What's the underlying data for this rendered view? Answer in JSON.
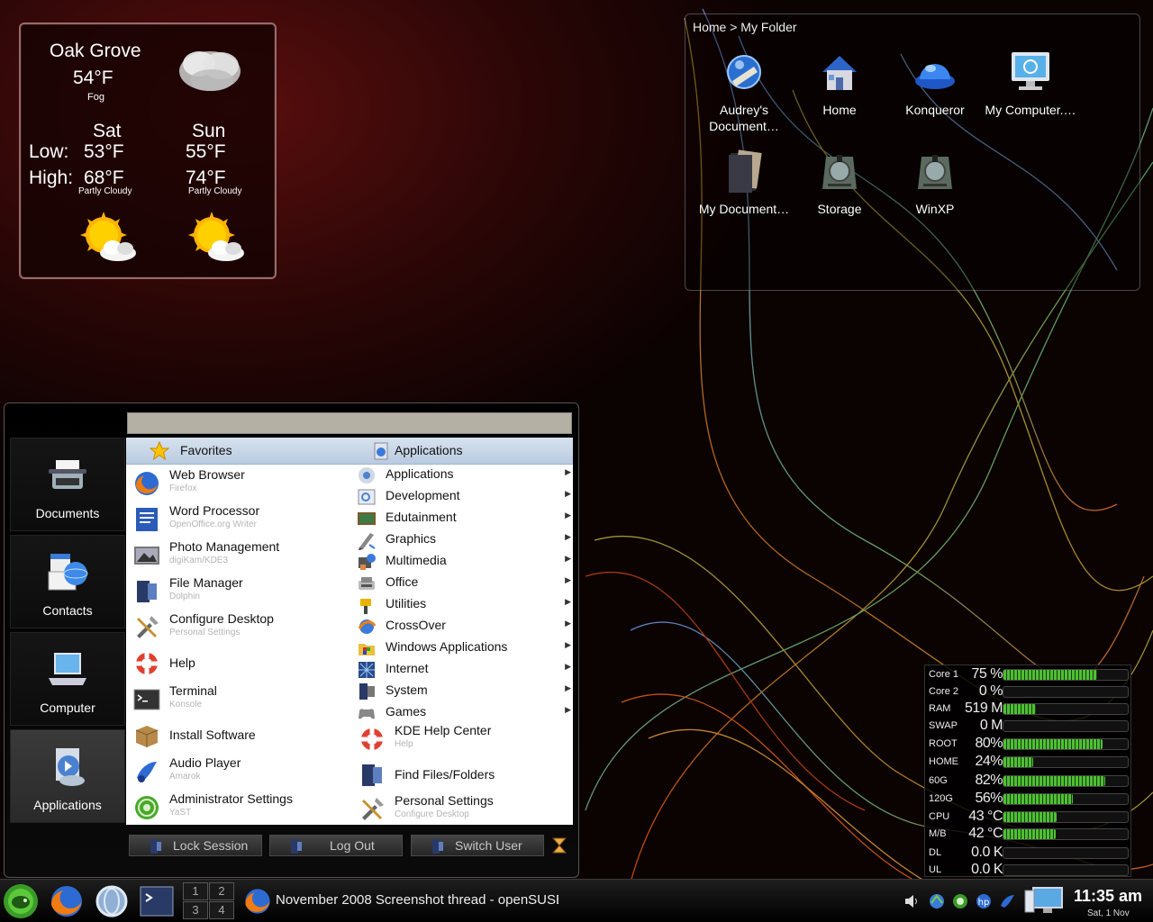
{
  "weather": {
    "city": "Oak Grove",
    "temp_now": "54°F",
    "condition_now": "Fog",
    "days": [
      {
        "day": "Sat",
        "low": "53°F",
        "high": "68°F",
        "condition": "Partly Cloudy"
      },
      {
        "day": "Sun",
        "low": "55°F",
        "high": "74°F",
        "condition": "Partly Cloudy"
      }
    ],
    "low_label": "Low:",
    "high_label": "High:"
  },
  "folder_view": {
    "breadcrumb": "Home > My Folder",
    "items": [
      {
        "label": "Audrey's Document…",
        "icon": "folder-documents-icon"
      },
      {
        "label": "Home",
        "icon": "home-icon"
      },
      {
        "label": "Konqueror",
        "icon": "konqueror-icon"
      },
      {
        "label": "My Computer.…",
        "icon": "computer-icon"
      },
      {
        "label": "My Document…",
        "icon": "documents-icon"
      },
      {
        "label": "Storage",
        "icon": "drive-icon"
      },
      {
        "label": "WinXP",
        "icon": "drive-icon"
      }
    ]
  },
  "menu": {
    "left_categories": [
      {
        "label": "Documents",
        "icon": "typewriter-icon"
      },
      {
        "label": "Contacts",
        "icon": "contacts-icon"
      },
      {
        "label": "Computer",
        "icon": "laptop-icon"
      },
      {
        "label": "Applications",
        "icon": "applications-icon"
      }
    ],
    "favorites_header": "Favorites",
    "applications_header": "Applications",
    "favorites": [
      {
        "name": "Web Browser",
        "desc": "Firefox",
        "icon": "firefox-icon"
      },
      {
        "name": "Word Processor",
        "desc": "OpenOffice.org Writer",
        "icon": "writer-icon"
      },
      {
        "name": "Photo Management",
        "desc": "digiKam/KDE3",
        "icon": "photo-icon"
      },
      {
        "name": "File Manager",
        "desc": "Dolphin",
        "icon": "file-manager-icon"
      },
      {
        "name": "Configure Desktop",
        "desc": "Personal Settings",
        "icon": "tools-icon"
      },
      {
        "name": "Help",
        "desc": "",
        "icon": "help-icon"
      },
      {
        "name": "Terminal",
        "desc": "Konsole",
        "icon": "terminal-icon"
      },
      {
        "name": "Install Software",
        "desc": "",
        "icon": "package-icon"
      },
      {
        "name": "Audio Player",
        "desc": "Amarok",
        "icon": "amarok-icon"
      },
      {
        "name": "Administrator Settings",
        "desc": "YaST",
        "icon": "yast-icon"
      }
    ],
    "applications": [
      {
        "name": "Applications",
        "icon": "applications-icon"
      },
      {
        "name": "Development",
        "icon": "development-icon"
      },
      {
        "name": "Edutainment",
        "icon": "edutainment-icon"
      },
      {
        "name": "Graphics",
        "icon": "graphics-icon"
      },
      {
        "name": "Multimedia",
        "icon": "multimedia-icon"
      },
      {
        "name": "Office",
        "icon": "office-icon"
      },
      {
        "name": "Utilities",
        "icon": "utilities-icon"
      },
      {
        "name": "CrossOver",
        "icon": "crossover-icon"
      },
      {
        "name": "Windows Applications",
        "icon": "windows-apps-icon"
      },
      {
        "name": "Internet",
        "icon": "internet-icon"
      },
      {
        "name": "System",
        "icon": "system-icon"
      },
      {
        "name": "Games",
        "icon": "games-icon"
      }
    ],
    "extra_items": [
      {
        "name": "KDE Help Center",
        "desc": "Help",
        "icon": "help-icon"
      },
      {
        "name": "Find Files/Folders",
        "desc": "",
        "icon": "find-icon"
      },
      {
        "name": "Personal Settings",
        "desc": "Configure Desktop",
        "icon": "tools-icon"
      }
    ],
    "buttons": {
      "lock": "Lock Session",
      "logout": "Log Out",
      "switch": "Switch User"
    }
  },
  "sysmon": [
    {
      "key": "Core 1",
      "value": "75 %",
      "level": 0.75
    },
    {
      "key": "Core 2",
      "value": "0 %",
      "level": 0
    },
    {
      "key": "RAM",
      "value": "519 M",
      "level": 0.26
    },
    {
      "key": "SWAP",
      "value": "0 M",
      "level": 0
    },
    {
      "key": "ROOT",
      "value": "80%",
      "level": 0.8
    },
    {
      "key": "HOME",
      "value": "24%",
      "level": 0.24
    },
    {
      "key": "60G",
      "value": "82%",
      "level": 0.82
    },
    {
      "key": "120G",
      "value": "56%",
      "level": 0.56
    },
    {
      "key": "CPU",
      "value": "43 °C",
      "level": 0.43
    },
    {
      "key": "M/B",
      "value": "42 °C",
      "level": 0.42
    },
    {
      "key": "DL",
      "value": "0.0 K",
      "level": 0
    },
    {
      "key": "UL",
      "value": "0.0 K",
      "level": 0
    }
  ],
  "taskbar": {
    "pager": [
      "1",
      "2",
      "3",
      "4"
    ],
    "task_title": "November 2008 Screenshot thread - openSUSE",
    "time": "11:35 am",
    "date": "Sat, 1 Nov"
  },
  "colors": {
    "accent_green": "#4ec032",
    "menu_header": "#c6d6e8"
  }
}
